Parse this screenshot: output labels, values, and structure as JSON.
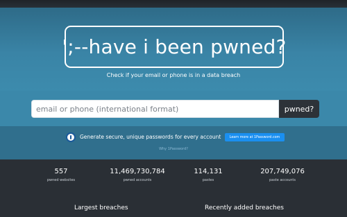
{
  "hero": {
    "logo_text": "';--have i been pwned?",
    "tagline": "Check if your email or phone is in a data breach"
  },
  "search": {
    "placeholder": "email or phone (international format)",
    "button_label": "pwned?"
  },
  "promo": {
    "icon": "1password-icon",
    "text": "Generate secure, unique passwords for every account",
    "button_label": "Learn more at 1Password.com",
    "why_link": "Why 1Password?"
  },
  "stats": [
    {
      "value": "557",
      "label": "pwned websites"
    },
    {
      "value": "11,469,730,784",
      "label": "pwned accounts"
    },
    {
      "value": "114,131",
      "label": "pastes"
    },
    {
      "value": "207,749,076",
      "label": "paste accounts"
    }
  ],
  "sections": {
    "largest_breaches": "Largest breaches",
    "recently_added": "Recently added breaches"
  },
  "colors": {
    "hero_top": "#2e6b88",
    "hero_bottom": "#3c8bad",
    "dark": "#2a2f35",
    "promo_button": "#1a8ff0"
  }
}
